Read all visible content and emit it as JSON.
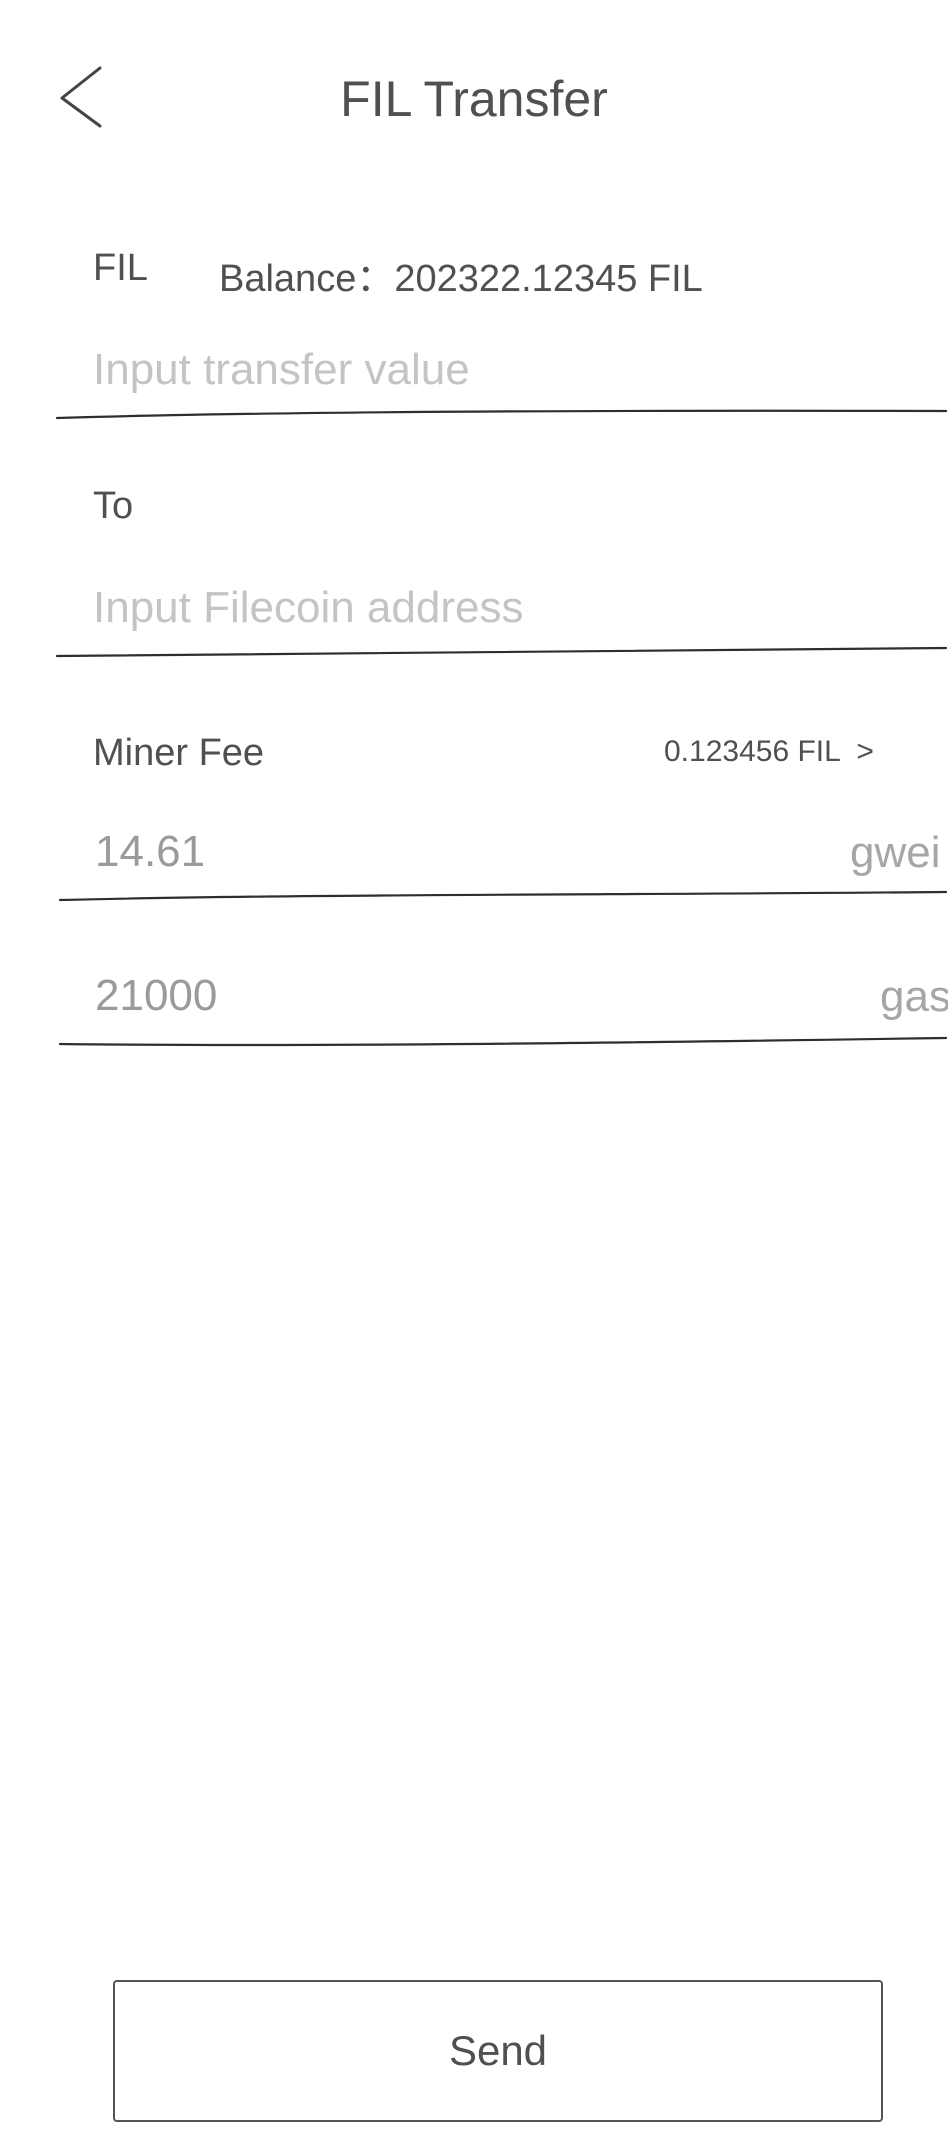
{
  "header": {
    "title": "FIL Transfer"
  },
  "amount": {
    "token_label": "FIL",
    "balance_label": "Balance：202322.12345 FIL",
    "placeholder": "Input transfer value"
  },
  "recipient": {
    "label": "To",
    "placeholder": "Input Filecoin address"
  },
  "fee": {
    "label": "Miner Fee",
    "amount_link": "0.123456 FIL  >",
    "gas_price": {
      "value": "14.61",
      "unit": "gwei"
    },
    "gas_limit": {
      "value": "21000",
      "unit": "gas"
    }
  },
  "actions": {
    "send_label": "Send"
  },
  "icons": {
    "back": "chevron-left-icon"
  }
}
